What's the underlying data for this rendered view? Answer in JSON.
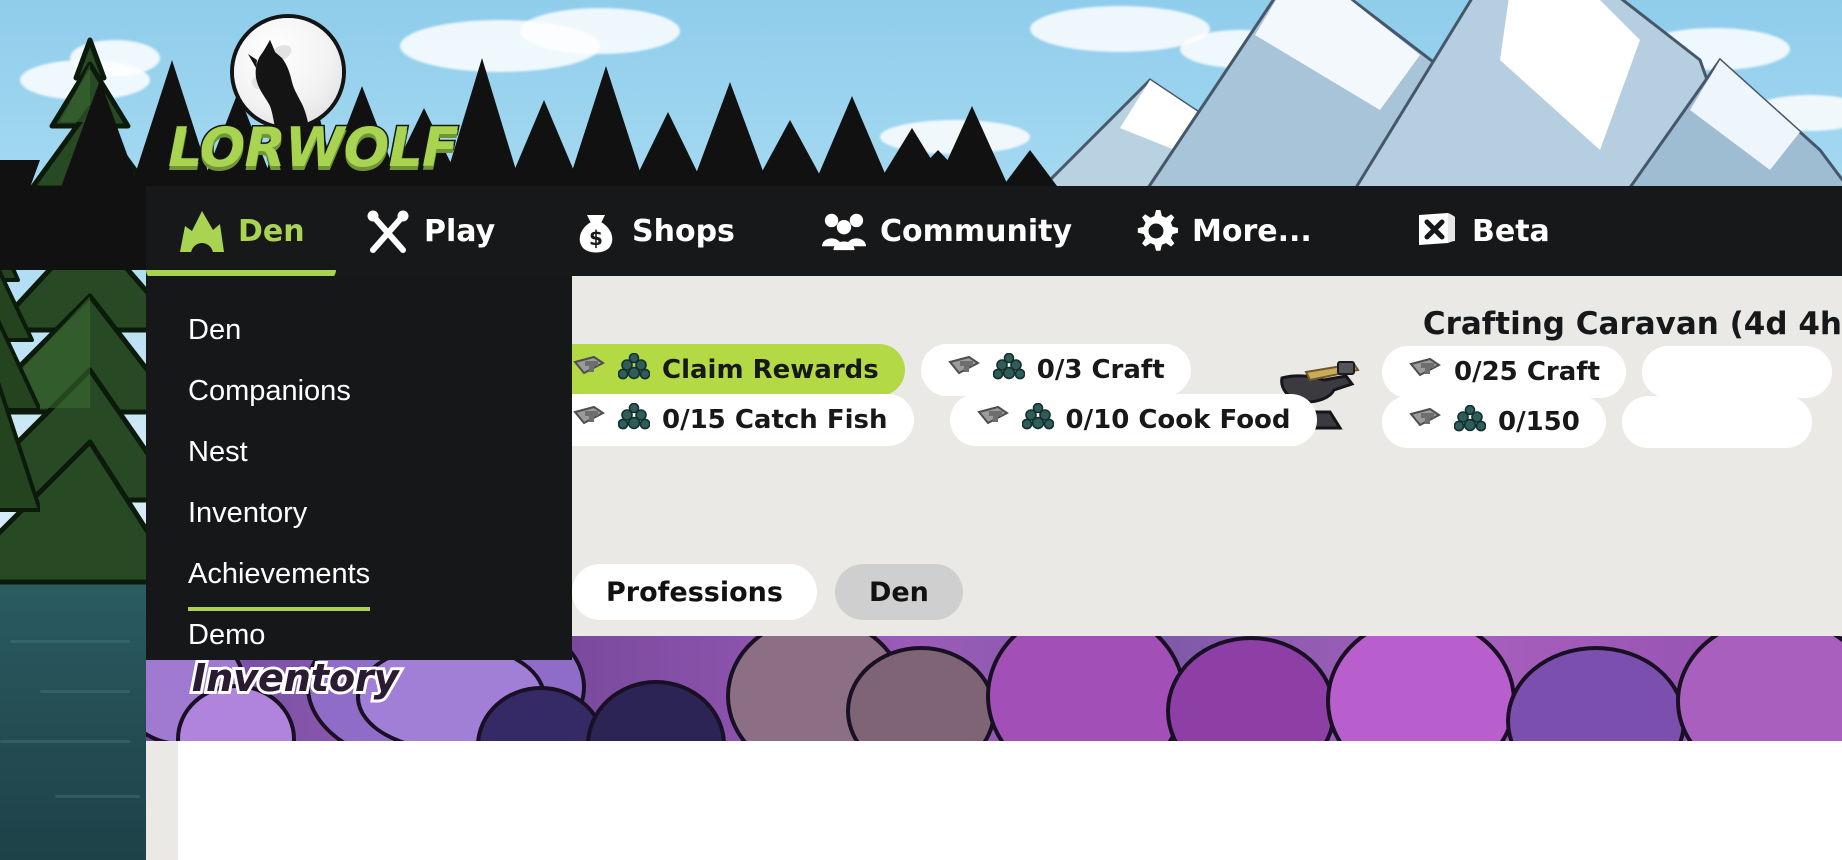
{
  "brand": {
    "name": "LORWOLF",
    "logo_icon": "wolf-howling-moon-logo"
  },
  "nav": {
    "items": [
      {
        "label": "Den",
        "icon": "mountain-icon",
        "active": true
      },
      {
        "label": "Play",
        "icon": "crossed-oars-icon",
        "active": false
      },
      {
        "label": "Shops",
        "icon": "money-bag-icon",
        "active": false
      },
      {
        "label": "Community",
        "icon": "people-group-icon",
        "active": false
      },
      {
        "label": "More...",
        "icon": "gear-icon",
        "active": false
      },
      {
        "label": "Beta",
        "icon": "flag-x-icon",
        "active": false
      }
    ]
  },
  "dropdown": {
    "open_for": "Den",
    "items": [
      {
        "label": "Den",
        "hover": false
      },
      {
        "label": "Companions",
        "hover": false
      },
      {
        "label": "Nest",
        "hover": false
      },
      {
        "label": "Inventory",
        "hover": false
      },
      {
        "label": "Achievements",
        "hover": true
      },
      {
        "label": "Demo",
        "hover": false
      }
    ]
  },
  "content": {
    "caravan": {
      "title": "Crafting Caravan (4d 4h",
      "icon": "anvil-icon",
      "chips": [
        {
          "label": "0/25 Craft",
          "icons": [
            "scroll-icon"
          ],
          "style": "white"
        },
        {
          "label": "0/150",
          "icons": [
            "scroll-icon",
            "ore-icon"
          ],
          "style": "white"
        }
      ]
    },
    "task_chips_row1": [
      {
        "label": "Claim Rewards",
        "icons": [
          "scroll-icon",
          "ore-icon"
        ],
        "style": "green"
      },
      {
        "label": "0/3 Craft",
        "icons": [
          "scroll-icon",
          "ore-icon"
        ],
        "style": "white"
      }
    ],
    "task_chips_row2": [
      {
        "label": "0/15 Catch Fish",
        "icons": [
          "scroll-icon",
          "ore-icon"
        ],
        "style": "white"
      },
      {
        "label": "0/10 Cook Food",
        "icons": [
          "scroll-icon",
          "ore-icon"
        ],
        "style": "white"
      }
    ],
    "tabs": [
      {
        "label": "Professions",
        "selected": false
      },
      {
        "label": "Den",
        "selected": true
      }
    ],
    "banner_title": "Inventory"
  },
  "colors": {
    "accent_green": "#a8d452",
    "chip_green": "#b3d945",
    "nav_bg": "#17181a",
    "dropdown_bg": "#161719",
    "panel_bg": "#eae9e5",
    "text_light": "#ffffff",
    "text_dark": "#17181a"
  }
}
